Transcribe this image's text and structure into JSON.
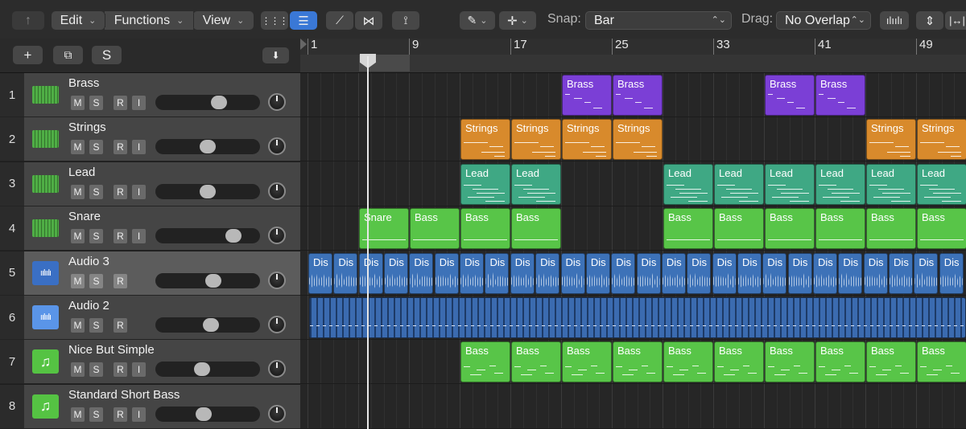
{
  "toolbar": {
    "edit": "Edit",
    "functions": "Functions",
    "view": "View",
    "snap_label": "Snap:",
    "snap_value": "Bar",
    "drag_label": "Drag:",
    "drag_value": "No Overlap"
  },
  "track_header_buttons": {
    "add": "+",
    "s": "S"
  },
  "ruler": [
    {
      "bar": "1"
    },
    {
      "bar": "9"
    },
    {
      "bar": "17"
    },
    {
      "bar": "25"
    },
    {
      "bar": "33"
    },
    {
      "bar": "41"
    },
    {
      "bar": "49"
    }
  ],
  "tracks": [
    {
      "num": "1",
      "name": "Brass",
      "icon": "keyboard-icon",
      "m": "M",
      "s": "S",
      "r": "R",
      "i": "I",
      "volume": 0.63
    },
    {
      "num": "2",
      "name": "Strings",
      "icon": "keyboard-icon",
      "m": "M",
      "s": "S",
      "r": "R",
      "i": "I",
      "volume": 0.5
    },
    {
      "num": "3",
      "name": "Lead",
      "icon": "keyboard-icon",
      "m": "M",
      "s": "S",
      "r": "R",
      "i": "I",
      "volume": 0.5
    },
    {
      "num": "4",
      "name": "Snare",
      "icon": "keyboard-icon",
      "m": "M",
      "s": "S",
      "r": "R",
      "i": "I",
      "volume": 0.79
    },
    {
      "num": "5",
      "name": "Audio 3",
      "icon": "waveform-icon",
      "m": "M",
      "s": "S",
      "r": "R",
      "volume": 0.56
    },
    {
      "num": "6",
      "name": "Audio 2",
      "icon": "waveform-icon",
      "m": "M",
      "s": "S",
      "r": "R",
      "volume": 0.54
    },
    {
      "num": "7",
      "name": "Nice But Simple",
      "icon": "music-note-icon",
      "m": "M",
      "s": "S",
      "r": "R",
      "i": "I",
      "volume": 0.44
    },
    {
      "num": "8",
      "name": "Standard Short Bass",
      "icon": "music-note-icon",
      "m": "M",
      "s": "S",
      "r": "R",
      "i": "I",
      "volume": 0.45
    }
  ],
  "regions": {
    "brass": {
      "label": "Brass",
      "color": "#7b3fd6"
    },
    "strings": {
      "label": "Strings",
      "color": "#d88a2c"
    },
    "lead": {
      "label": "Lead",
      "color": "#3fa884"
    },
    "snare": {
      "label": "Snare",
      "color": "#58c548"
    },
    "bass_snare": {
      "label": "Bass",
      "color": "#58c548"
    },
    "dis": {
      "label": "Dis",
      "color": "#3d72b8"
    },
    "bass": {
      "label": "Bass",
      "color": "#58c548"
    }
  },
  "colors": {
    "keyboard_icon": "#4fae45",
    "audio3_icon": "#3a6fc4",
    "audio2_icon": "#5a95e8",
    "note_icon": "#55c343"
  }
}
